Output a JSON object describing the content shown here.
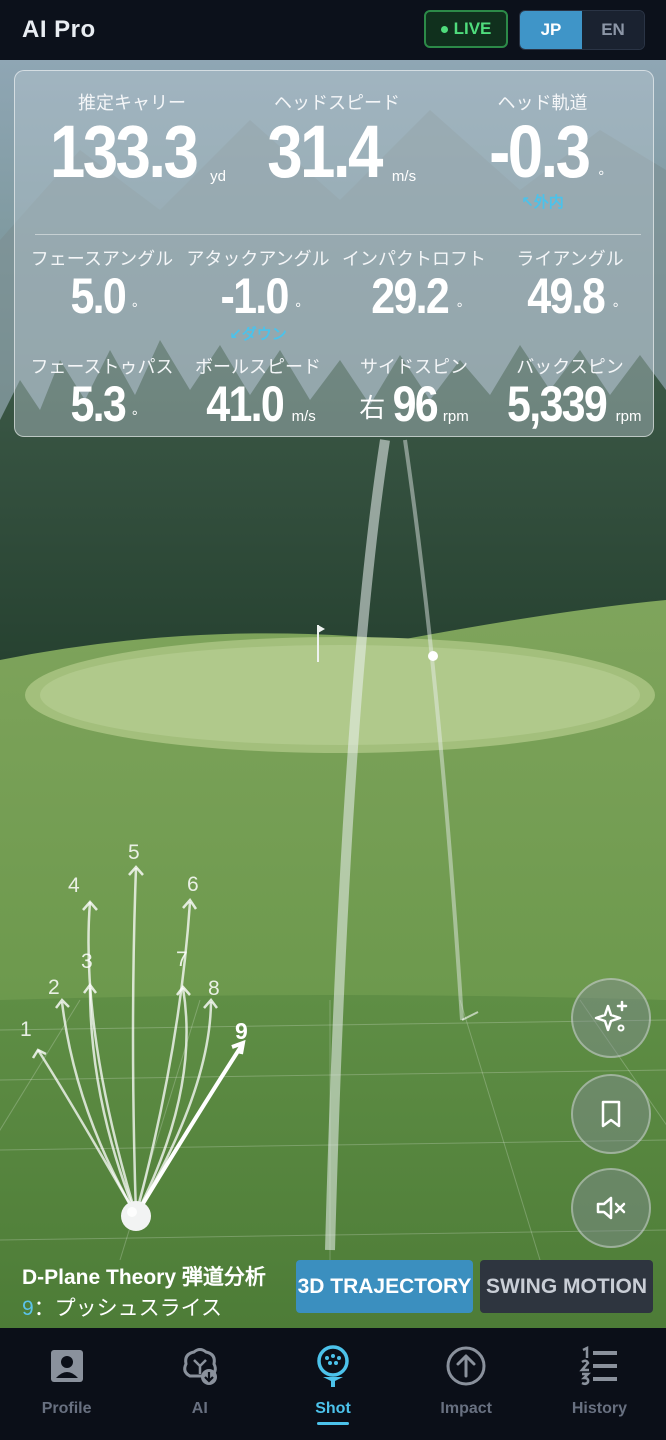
{
  "app": {
    "title": "AI Pro"
  },
  "header": {
    "live_label": "LIVE",
    "lang": {
      "jp": "JP",
      "en": "EN",
      "active": "JP"
    }
  },
  "metrics": {
    "primary": [
      {
        "label": "推定キャリー",
        "value": "133.3",
        "unit": "yd"
      },
      {
        "label": "ヘッドスピード",
        "value": "31.4",
        "unit": "m/s"
      },
      {
        "label": "ヘッド軌道",
        "value": "-0.3",
        "unit": "°",
        "sub": "↖外内"
      }
    ],
    "secondary": [
      {
        "label": "フェースアングル",
        "value": "5.0",
        "unit": "°"
      },
      {
        "label": "アタックアングル",
        "value": "-1.0",
        "unit": "°",
        "sub": "↙ダウン"
      },
      {
        "label": "インパクトロフト",
        "value": "29.2",
        "unit": "°"
      },
      {
        "label": "ライアングル",
        "value": "49.8",
        "unit": "°"
      },
      {
        "label": "フェーストゥパス",
        "value": "5.3",
        "unit": "°"
      },
      {
        "label": "ボールスピード",
        "value": "41.0",
        "unit": "m/s"
      },
      {
        "label": "サイドスピン",
        "prefix": "右",
        "value": "96",
        "unit": "rpm"
      },
      {
        "label": "バックスピン",
        "value": "5,339",
        "unit": "rpm"
      }
    ]
  },
  "dplane": {
    "labels": [
      "1",
      "2",
      "3",
      "4",
      "5",
      "6",
      "7",
      "8",
      "9"
    ],
    "selected": "9",
    "title": "D-Plane Theory 弾道分析",
    "result_num": "9",
    "result_text": "：プッシュスライス"
  },
  "modes": {
    "trajectory": "3D TRAJECTORY",
    "swing": "SWING MOTION",
    "active": "3D TRAJECTORY"
  },
  "fabs": {
    "ai_icon": "sparkle-icon",
    "bookmark_icon": "bookmark-icon",
    "mute_icon": "speaker-mute-icon"
  },
  "nav": {
    "items": [
      {
        "label": "Profile",
        "icon": "profile-card-icon"
      },
      {
        "label": "AI",
        "icon": "brain-icon"
      },
      {
        "label": "Shot",
        "icon": "golf-ball-tee-icon"
      },
      {
        "label": "Impact",
        "icon": "arrow-up-circle-icon"
      },
      {
        "label": "History",
        "icon": "numbered-list-icon"
      }
    ],
    "active": "Shot"
  },
  "colors": {
    "accent": "#4cc2ea",
    "live": "#4fdc7c",
    "active_button": "#3b8fbf"
  }
}
